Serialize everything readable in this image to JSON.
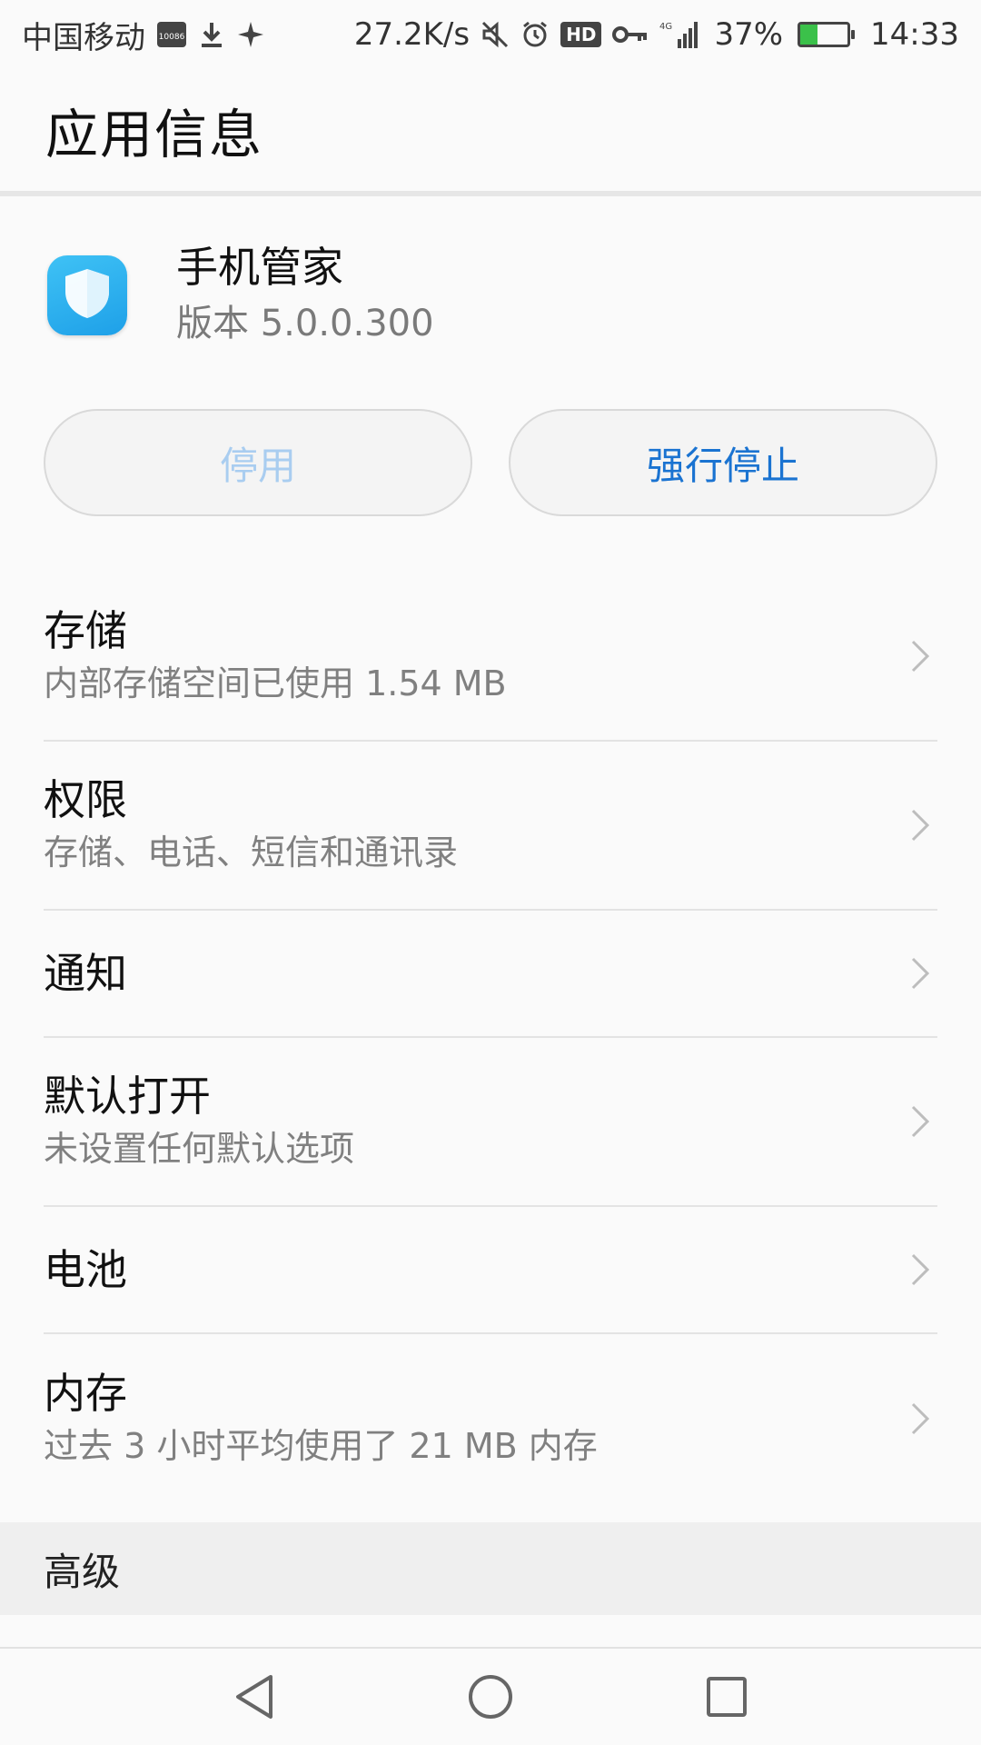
{
  "status_bar": {
    "carrier": "中国移动",
    "carrier_badge": "10086",
    "net_speed": "27.2K/s",
    "hd": "HD",
    "network": "4G",
    "battery_percent": "37%",
    "battery_level": 0.37,
    "time": "14:33",
    "icons": [
      "download-icon",
      "sparkle-icon",
      "mute-icon",
      "alarm-icon",
      "key-icon",
      "signal-icon"
    ]
  },
  "header": {
    "title": "应用信息"
  },
  "app": {
    "name": "手机管家",
    "version": "版本 5.0.0.300",
    "icon": "shield-icon",
    "icon_color": "#2db1f0"
  },
  "buttons": {
    "disable_label": "停用",
    "force_stop_label": "强行停止",
    "disabled_color": "#a9cdf0",
    "accent_color": "#1a73d1"
  },
  "items": [
    {
      "title": "存储",
      "subtitle": "内部存储空间已使用 1.54 MB"
    },
    {
      "title": "权限",
      "subtitle": "存储、电话、短信和通讯录"
    },
    {
      "title": "通知"
    },
    {
      "title": "默认打开",
      "subtitle": "未设置任何默认选项"
    },
    {
      "title": "电池"
    },
    {
      "title": "内存",
      "subtitle": "过去 3 小时平均使用了 21 MB 内存"
    }
  ],
  "section": {
    "title": "高级"
  },
  "nav": [
    "back-icon",
    "home-icon",
    "recents-icon"
  ]
}
